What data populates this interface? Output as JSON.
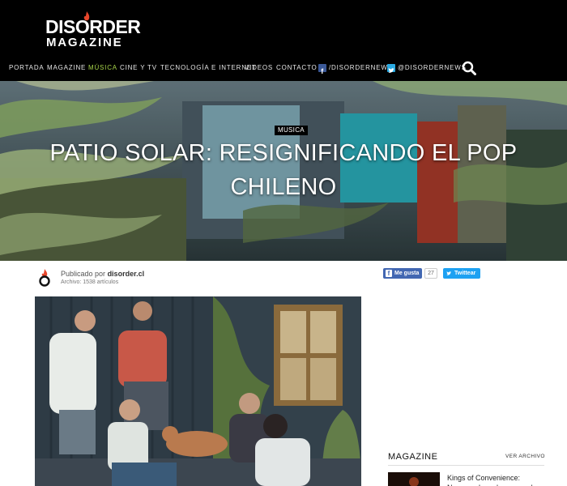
{
  "brand": {
    "line1": "DISORDER",
    "line2": "MAGAZINE"
  },
  "nav": {
    "items": [
      "PORTADA",
      "MAGAZINE",
      "MÚSICA",
      "CINE Y TV",
      "TECNOLOGÍA E INTERNET",
      "VIDEOS",
      "CONTACTO"
    ],
    "active": "MÚSICA",
    "facebook": "/DISORDERNEWS",
    "twitter": "@DISORDERNEWS"
  },
  "hero": {
    "tag": "MUSICA",
    "title": "PATIO SOLAR: RESIGNIFICANDO EL POP CHILENO"
  },
  "author": {
    "published": "Publicado por",
    "name": "disorder.cl",
    "archive": "Archivo: 1538 artículos"
  },
  "share": {
    "like_label": "Me gusta",
    "like_count": "27",
    "tweet_label": "Twittear"
  },
  "sidebar": {
    "title": "MAGAZINE",
    "more": "VER ARCHIVO",
    "items": [
      {
        "title": "Kings of Convenience: Navegando en los recuerdos"
      }
    ]
  },
  "colors": {
    "header_bg": "#000000",
    "nav_active": "#a8d54a",
    "facebook": "#3b5998",
    "twitter": "#1da1f2"
  }
}
